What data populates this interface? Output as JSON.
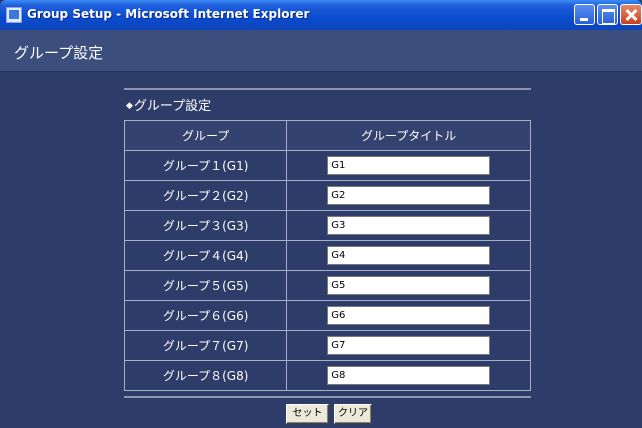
{
  "window": {
    "title": "Group Setup - Microsoft Internet Explorer"
  },
  "page": {
    "header": "グループ設定",
    "section_title": "グループ設定"
  },
  "table": {
    "headers": [
      "グループ",
      "グループタイトル"
    ],
    "rows": [
      {
        "group": "グループ１(G1)",
        "title": "G1"
      },
      {
        "group": "グループ２(G2)",
        "title": "G2"
      },
      {
        "group": "グループ３(G3)",
        "title": "G3"
      },
      {
        "group": "グループ４(G4)",
        "title": "G4"
      },
      {
        "group": "グループ５(G5)",
        "title": "G5"
      },
      {
        "group": "グループ６(G6)",
        "title": "G6"
      },
      {
        "group": "グループ７(G7)",
        "title": "G7"
      },
      {
        "group": "グループ８(G8)",
        "title": "G8"
      }
    ]
  },
  "buttons": {
    "set": "セット",
    "clear": "クリア"
  },
  "icons": {
    "app": "ie-page-icon",
    "minimize": "minimize-icon",
    "maximize": "maximize-icon",
    "close": "close-icon"
  }
}
